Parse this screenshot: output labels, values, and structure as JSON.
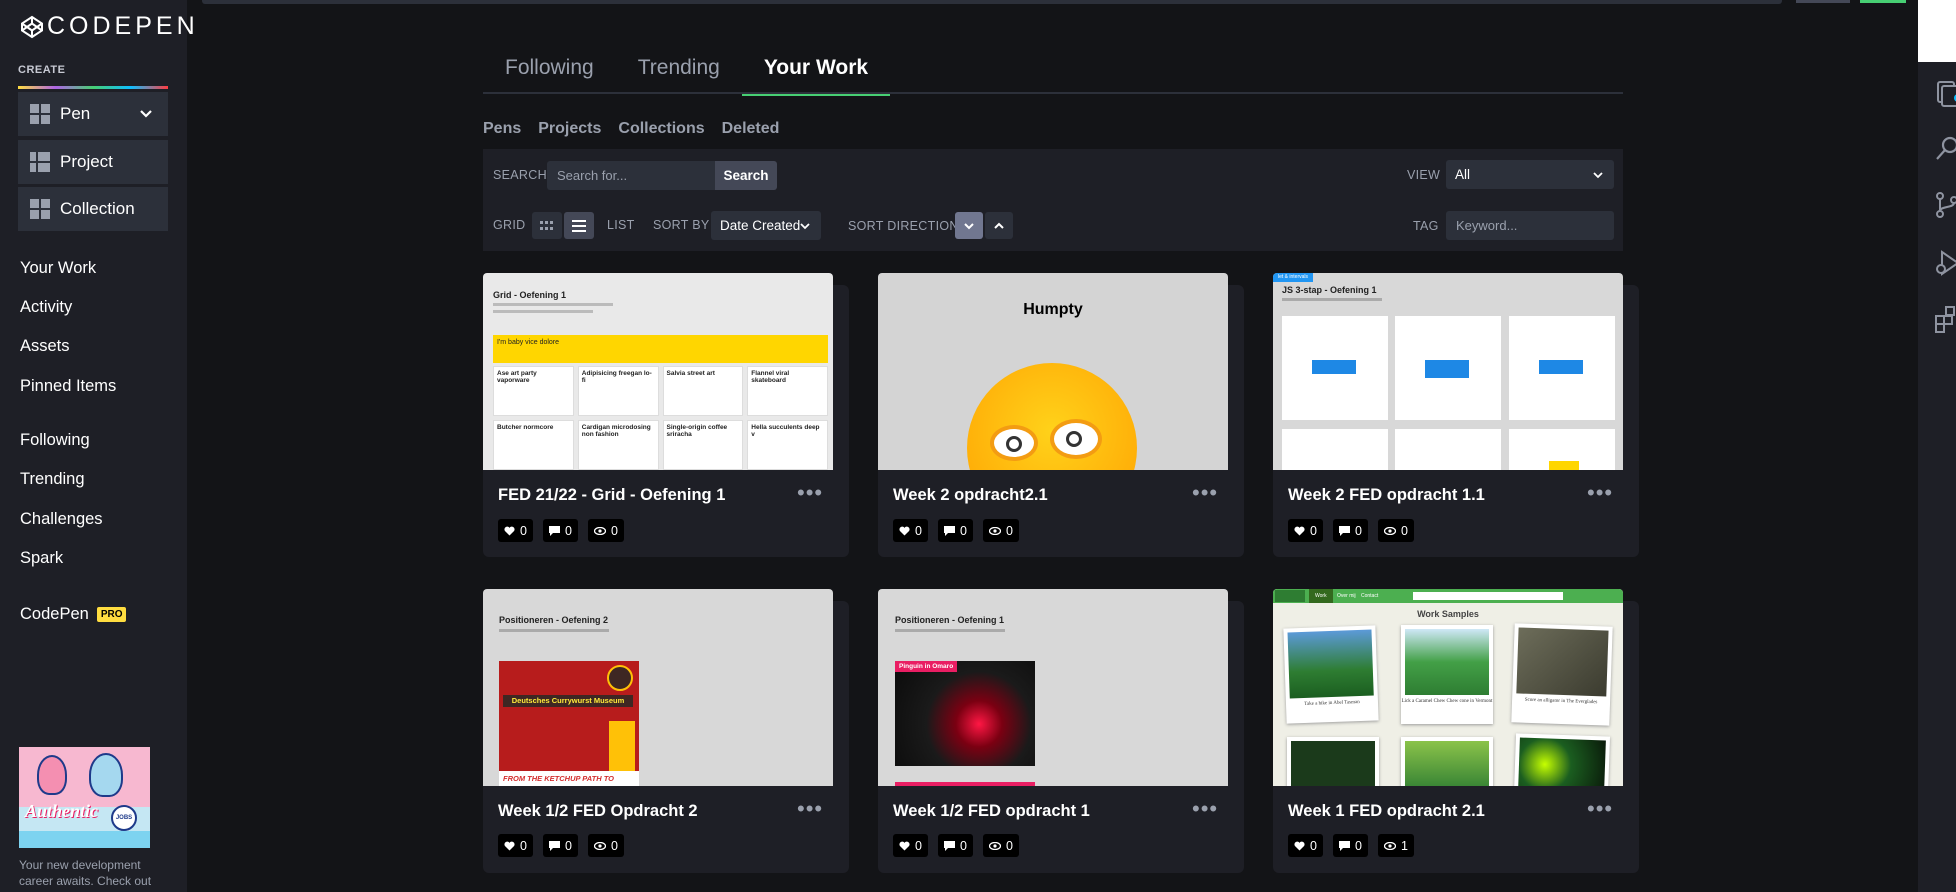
{
  "brand": {
    "logo_text": "CODEPEN"
  },
  "sidebar": {
    "create_label": "CREATE",
    "create_items": [
      {
        "label": "Pen"
      },
      {
        "label": "Project"
      },
      {
        "label": "Collection"
      }
    ],
    "nav_primary": [
      "Your Work",
      "Activity",
      "Assets",
      "Pinned Items"
    ],
    "nav_secondary": [
      "Following",
      "Trending",
      "Challenges",
      "Spark"
    ],
    "codepen_pro": {
      "label": "CodePen",
      "badge": "PRO"
    },
    "promo": {
      "image_text": "Authentic",
      "badge_text": "JOBS",
      "text": "Your new development career awaits. Check out"
    }
  },
  "main": {
    "tabs": [
      "Following",
      "Trending",
      "Your Work"
    ],
    "active_tab": "Your Work",
    "subtabs": [
      "Pens",
      "Projects",
      "Collections",
      "Deleted"
    ],
    "search": {
      "label": "SEARCH",
      "placeholder": "Search for...",
      "button": "Search"
    },
    "view": {
      "label": "VIEW",
      "value": "All"
    },
    "grid_label": "GRID",
    "list_label": "LIST",
    "sort_by": {
      "label": "SORT BY",
      "value": "Date Created"
    },
    "sort_direction": {
      "label": "SORT DIRECTION"
    },
    "tag": {
      "label": "TAG",
      "placeholder": "Keyword..."
    }
  },
  "cards": [
    {
      "title": "FED 21/22 - Grid - Oefening 1",
      "likes": "0",
      "comments": "0",
      "views": "0"
    },
    {
      "title": "Week 2 opdracht2.1",
      "likes": "0",
      "comments": "0",
      "views": "0"
    },
    {
      "title": "Week 2 FED opdracht 1.1",
      "likes": "0",
      "comments": "0",
      "views": "0"
    },
    {
      "title": "Week 1/2 FED Opdracht 2",
      "likes": "0",
      "comments": "0",
      "views": "0"
    },
    {
      "title": "Week 1/2 FED opdracht 1",
      "likes": "0",
      "comments": "0",
      "views": "0"
    },
    {
      "title": "Week 1 FED opdracht 2.1",
      "likes": "0",
      "comments": "0",
      "views": "1"
    }
  ],
  "thumbnails": {
    "grid": {
      "title": "Grid - Oefening 1",
      "banner": "I'm baby vice dolore",
      "cells": [
        "Ase art party vaporware",
        "Adipisicing freegan lo-fi",
        "Salvia street art",
        "Flannel viral skateboard",
        "Butcher normcore",
        "Cardigan microdosing non fashion",
        "Single-origin coffee sriracha",
        "Hella succulents deep v"
      ]
    },
    "humpty": {
      "title": "Humpty"
    },
    "js3stap": {
      "tag": "let & intervals",
      "title": "JS 3-stap - Oefening 1"
    },
    "pos2": {
      "title": "Positioneren - Oefening 2",
      "sign": "Deutsches Currywurst Museum",
      "slogan": "FROM THE KETCHUP PATH TO"
    },
    "pos1": {
      "title": "Positioneren - Oefening 1",
      "label": "Pinguin in Omaro"
    },
    "samples": {
      "title": "Work Samples",
      "nav": [
        "Work",
        "Over mij",
        "Contact"
      ],
      "captions": [
        "Take a hike in Abel Tasman",
        "Lick a Caramel Chew Chew cone in Vermont",
        "Score an alligator in The Everglades"
      ]
    }
  }
}
